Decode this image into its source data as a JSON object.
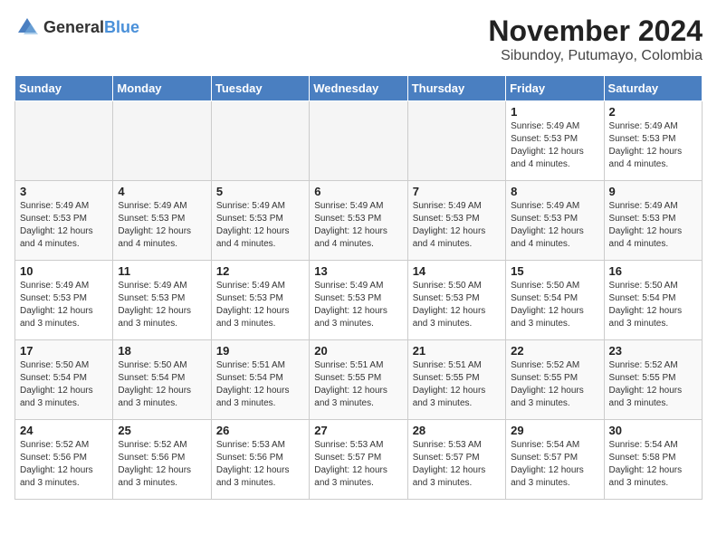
{
  "header": {
    "logo_general": "General",
    "logo_blue": "Blue",
    "month": "November 2024",
    "location": "Sibundoy, Putumayo, Colombia"
  },
  "weekdays": [
    "Sunday",
    "Monday",
    "Tuesday",
    "Wednesday",
    "Thursday",
    "Friday",
    "Saturday"
  ],
  "weeks": [
    [
      {
        "day": "",
        "info": ""
      },
      {
        "day": "",
        "info": ""
      },
      {
        "day": "",
        "info": ""
      },
      {
        "day": "",
        "info": ""
      },
      {
        "day": "",
        "info": ""
      },
      {
        "day": "1",
        "info": "Sunrise: 5:49 AM\nSunset: 5:53 PM\nDaylight: 12 hours\nand 4 minutes."
      },
      {
        "day": "2",
        "info": "Sunrise: 5:49 AM\nSunset: 5:53 PM\nDaylight: 12 hours\nand 4 minutes."
      }
    ],
    [
      {
        "day": "3",
        "info": "Sunrise: 5:49 AM\nSunset: 5:53 PM\nDaylight: 12 hours\nand 4 minutes."
      },
      {
        "day": "4",
        "info": "Sunrise: 5:49 AM\nSunset: 5:53 PM\nDaylight: 12 hours\nand 4 minutes."
      },
      {
        "day": "5",
        "info": "Sunrise: 5:49 AM\nSunset: 5:53 PM\nDaylight: 12 hours\nand 4 minutes."
      },
      {
        "day": "6",
        "info": "Sunrise: 5:49 AM\nSunset: 5:53 PM\nDaylight: 12 hours\nand 4 minutes."
      },
      {
        "day": "7",
        "info": "Sunrise: 5:49 AM\nSunset: 5:53 PM\nDaylight: 12 hours\nand 4 minutes."
      },
      {
        "day": "8",
        "info": "Sunrise: 5:49 AM\nSunset: 5:53 PM\nDaylight: 12 hours\nand 4 minutes."
      },
      {
        "day": "9",
        "info": "Sunrise: 5:49 AM\nSunset: 5:53 PM\nDaylight: 12 hours\nand 4 minutes."
      }
    ],
    [
      {
        "day": "10",
        "info": "Sunrise: 5:49 AM\nSunset: 5:53 PM\nDaylight: 12 hours\nand 3 minutes."
      },
      {
        "day": "11",
        "info": "Sunrise: 5:49 AM\nSunset: 5:53 PM\nDaylight: 12 hours\nand 3 minutes."
      },
      {
        "day": "12",
        "info": "Sunrise: 5:49 AM\nSunset: 5:53 PM\nDaylight: 12 hours\nand 3 minutes."
      },
      {
        "day": "13",
        "info": "Sunrise: 5:49 AM\nSunset: 5:53 PM\nDaylight: 12 hours\nand 3 minutes."
      },
      {
        "day": "14",
        "info": "Sunrise: 5:50 AM\nSunset: 5:53 PM\nDaylight: 12 hours\nand 3 minutes."
      },
      {
        "day": "15",
        "info": "Sunrise: 5:50 AM\nSunset: 5:54 PM\nDaylight: 12 hours\nand 3 minutes."
      },
      {
        "day": "16",
        "info": "Sunrise: 5:50 AM\nSunset: 5:54 PM\nDaylight: 12 hours\nand 3 minutes."
      }
    ],
    [
      {
        "day": "17",
        "info": "Sunrise: 5:50 AM\nSunset: 5:54 PM\nDaylight: 12 hours\nand 3 minutes."
      },
      {
        "day": "18",
        "info": "Sunrise: 5:50 AM\nSunset: 5:54 PM\nDaylight: 12 hours\nand 3 minutes."
      },
      {
        "day": "19",
        "info": "Sunrise: 5:51 AM\nSunset: 5:54 PM\nDaylight: 12 hours\nand 3 minutes."
      },
      {
        "day": "20",
        "info": "Sunrise: 5:51 AM\nSunset: 5:55 PM\nDaylight: 12 hours\nand 3 minutes."
      },
      {
        "day": "21",
        "info": "Sunrise: 5:51 AM\nSunset: 5:55 PM\nDaylight: 12 hours\nand 3 minutes."
      },
      {
        "day": "22",
        "info": "Sunrise: 5:52 AM\nSunset: 5:55 PM\nDaylight: 12 hours\nand 3 minutes."
      },
      {
        "day": "23",
        "info": "Sunrise: 5:52 AM\nSunset: 5:55 PM\nDaylight: 12 hours\nand 3 minutes."
      }
    ],
    [
      {
        "day": "24",
        "info": "Sunrise: 5:52 AM\nSunset: 5:56 PM\nDaylight: 12 hours\nand 3 minutes."
      },
      {
        "day": "25",
        "info": "Sunrise: 5:52 AM\nSunset: 5:56 PM\nDaylight: 12 hours\nand 3 minutes."
      },
      {
        "day": "26",
        "info": "Sunrise: 5:53 AM\nSunset: 5:56 PM\nDaylight: 12 hours\nand 3 minutes."
      },
      {
        "day": "27",
        "info": "Sunrise: 5:53 AM\nSunset: 5:57 PM\nDaylight: 12 hours\nand 3 minutes."
      },
      {
        "day": "28",
        "info": "Sunrise: 5:53 AM\nSunset: 5:57 PM\nDaylight: 12 hours\nand 3 minutes."
      },
      {
        "day": "29",
        "info": "Sunrise: 5:54 AM\nSunset: 5:57 PM\nDaylight: 12 hours\nand 3 minutes."
      },
      {
        "day": "30",
        "info": "Sunrise: 5:54 AM\nSunset: 5:58 PM\nDaylight: 12 hours\nand 3 minutes."
      }
    ]
  ]
}
